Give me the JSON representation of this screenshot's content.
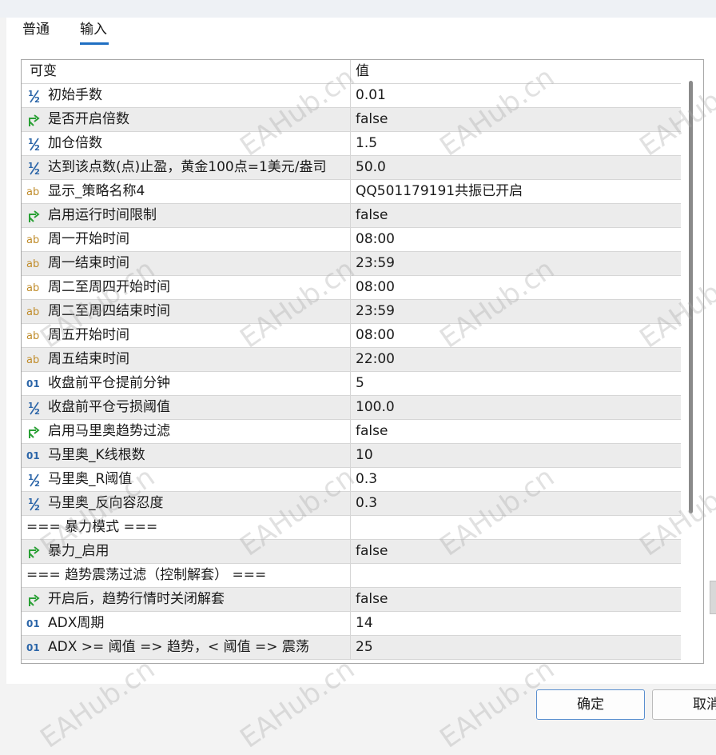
{
  "tabs": [
    {
      "label": "普通",
      "active": false
    },
    {
      "label": "输入",
      "active": true
    }
  ],
  "table": {
    "header": {
      "name": "可变",
      "value": "值"
    },
    "rows": [
      {
        "type": "double",
        "icon": "half-icon",
        "name": "初始手数",
        "value": "0.01"
      },
      {
        "type": "bool",
        "icon": "arrow-icon",
        "name": "是否开启倍数",
        "value": "false"
      },
      {
        "type": "double",
        "icon": "half-icon",
        "name": "加仓倍数",
        "value": "1.5"
      },
      {
        "type": "double",
        "icon": "half-icon",
        "name": "达到该点数(点)止盈，黄金100点=1美元/盎司",
        "value": "50.0"
      },
      {
        "type": "string",
        "icon": "ab-icon",
        "name": "显示_策略名称4",
        "value": "QQ501179191共振已开启"
      },
      {
        "type": "bool",
        "icon": "arrow-icon",
        "name": "启用运行时间限制",
        "value": "false"
      },
      {
        "type": "string",
        "icon": "ab-icon",
        "name": "周一开始时间",
        "value": "08:00"
      },
      {
        "type": "string",
        "icon": "ab-icon",
        "name": "周一结束时间",
        "value": "23:59"
      },
      {
        "type": "string",
        "icon": "ab-icon",
        "name": "周二至周四开始时间",
        "value": "08:00"
      },
      {
        "type": "string",
        "icon": "ab-icon",
        "name": "周二至周四结束时间",
        "value": "23:59"
      },
      {
        "type": "string",
        "icon": "ab-icon",
        "name": "周五开始时间",
        "value": "08:00"
      },
      {
        "type": "string",
        "icon": "ab-icon",
        "name": "周五结束时间",
        "value": "22:00"
      },
      {
        "type": "int",
        "icon": "01-icon",
        "name": "收盘前平仓提前分钟",
        "value": "5"
      },
      {
        "type": "double",
        "icon": "half-icon",
        "name": "收盘前平仓亏损阈值",
        "value": "100.0"
      },
      {
        "type": "bool",
        "icon": "arrow-icon",
        "name": "启用马里奥趋势过滤",
        "value": "false"
      },
      {
        "type": "int",
        "icon": "01-icon",
        "name": "马里奥_K线根数",
        "value": "10"
      },
      {
        "type": "double",
        "icon": "half-icon",
        "name": "马里奥_R阈值",
        "value": "0.3"
      },
      {
        "type": "double",
        "icon": "half-icon",
        "name": "马里奥_反向容忍度",
        "value": "0.3"
      },
      {
        "type": "section",
        "icon": "",
        "name": "=== 暴力模式 ===",
        "value": ""
      },
      {
        "type": "bool",
        "icon": "arrow-icon",
        "name": "暴力_启用",
        "value": "false"
      },
      {
        "type": "section",
        "icon": "",
        "name": "=== 趋势震荡过滤（控制解套） ===",
        "value": ""
      },
      {
        "type": "bool",
        "icon": "arrow-icon",
        "name": "开启后，趋势行情时关闭解套",
        "value": "false"
      },
      {
        "type": "int",
        "icon": "01-icon",
        "name": "ADX周期",
        "value": "14"
      },
      {
        "type": "int",
        "icon": "01-icon",
        "name": "ADX >= 阈值 => 趋势，< 阈值 => 震荡",
        "value": "25"
      }
    ]
  },
  "buttons": {
    "ok": "确定",
    "cancel": "取消"
  },
  "watermark": "EAHub.cn",
  "colors": {
    "accent": "#1f6fc2",
    "half_icon": "#2b65a8",
    "arrow_icon": "#2aa035",
    "ab_icon": "#c08c2a"
  }
}
